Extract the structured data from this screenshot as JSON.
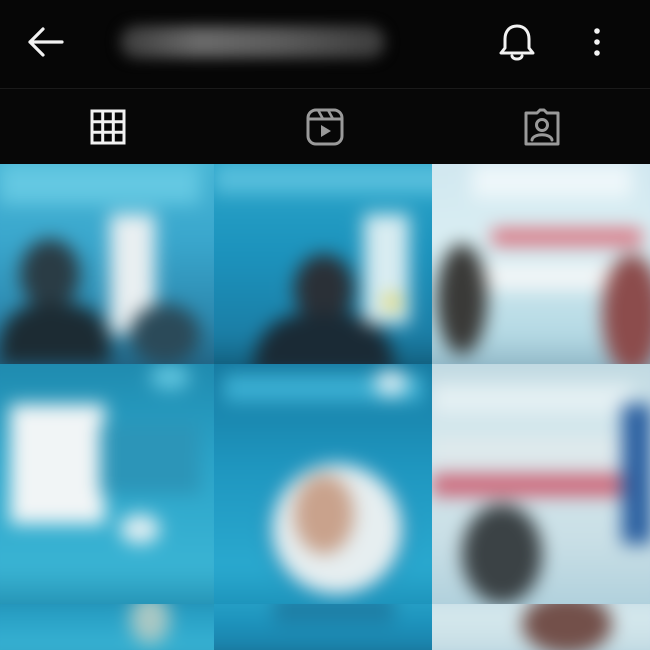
{
  "header": {
    "back_icon": "arrow-left-icon",
    "username": "",
    "notifications_icon": "bell-icon",
    "more_icon": "more-vertical-icon"
  },
  "tabs": [
    {
      "name": "posts-grid",
      "icon": "grid-icon",
      "active": true
    },
    {
      "name": "reels",
      "icon": "reels-icon",
      "active": false
    },
    {
      "name": "tagged",
      "icon": "tagged-person-icon",
      "active": false
    }
  ],
  "grid": {
    "columns": 3,
    "tiles_visible": 9
  },
  "colors": {
    "background": "#060606",
    "icon": "#f2f2f2",
    "inactive_icon": "#9a9a9a",
    "tile_accent": "#2aa3c8"
  }
}
